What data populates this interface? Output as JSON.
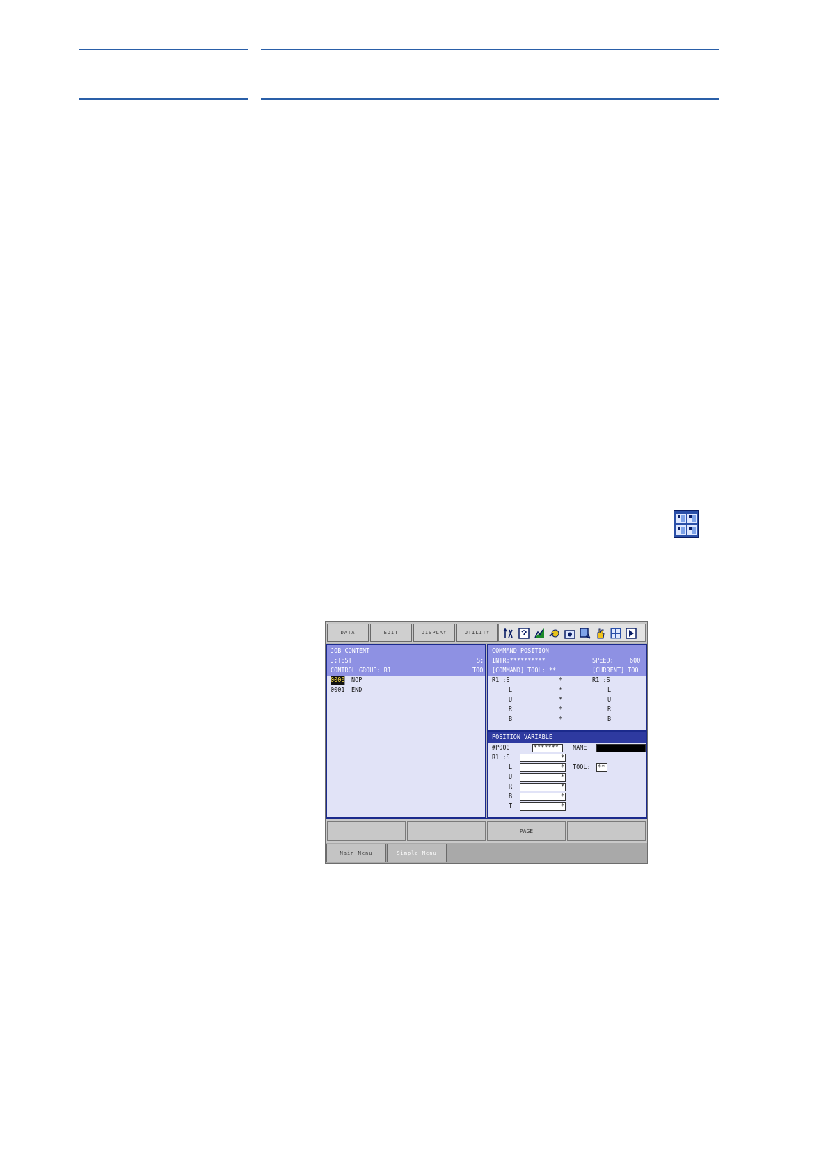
{
  "toolbar": {
    "menus": [
      "DATA",
      "EDIT",
      "DISPLAY",
      "UTILITY"
    ],
    "icons": [
      "coordinate-icon",
      "help-icon",
      "speed-icon",
      "tool-icon",
      "camera-icon",
      "page-icon",
      "hand-icon",
      "multi-window-icon",
      "play-icon"
    ]
  },
  "job_panel": {
    "title": "JOB CONTENT",
    "job": "J:TEST",
    "group": "CONTROL GROUP: R1",
    "s_label": "S:",
    "too_label": "TOO",
    "lines": [
      {
        "num": "0000",
        "text": "NOP"
      },
      {
        "num": "0001",
        "text": "END"
      }
    ]
  },
  "command_panel": {
    "title": "COMMAND POSITION",
    "intr": "INTR:**********",
    "speed_label": "SPEED:",
    "speed_value": "600",
    "command_label": "[COMMAND] TOOL: **",
    "current_label": "[CURRENT] TOO",
    "group": "R1 :S",
    "axes": [
      "L",
      "U",
      "R",
      "B"
    ],
    "values": [
      "*",
      "*",
      "*",
      "*",
      "*"
    ]
  },
  "variable_panel": {
    "title": "POSITION VARIABLE",
    "number": "#P000",
    "number_value": "*******",
    "name_label": "NAME",
    "group": "R1 :S",
    "axes": [
      "L",
      "U",
      "R",
      "B",
      "T"
    ],
    "values": [
      "*",
      "*",
      "*",
      "*",
      "*",
      "*"
    ],
    "tool_label": "TOOL:",
    "tool_value": "**"
  },
  "function_keys": [
    "",
    "",
    "PAGE",
    ""
  ],
  "tabs": [
    "Main Menu",
    "Simple Menu"
  ]
}
